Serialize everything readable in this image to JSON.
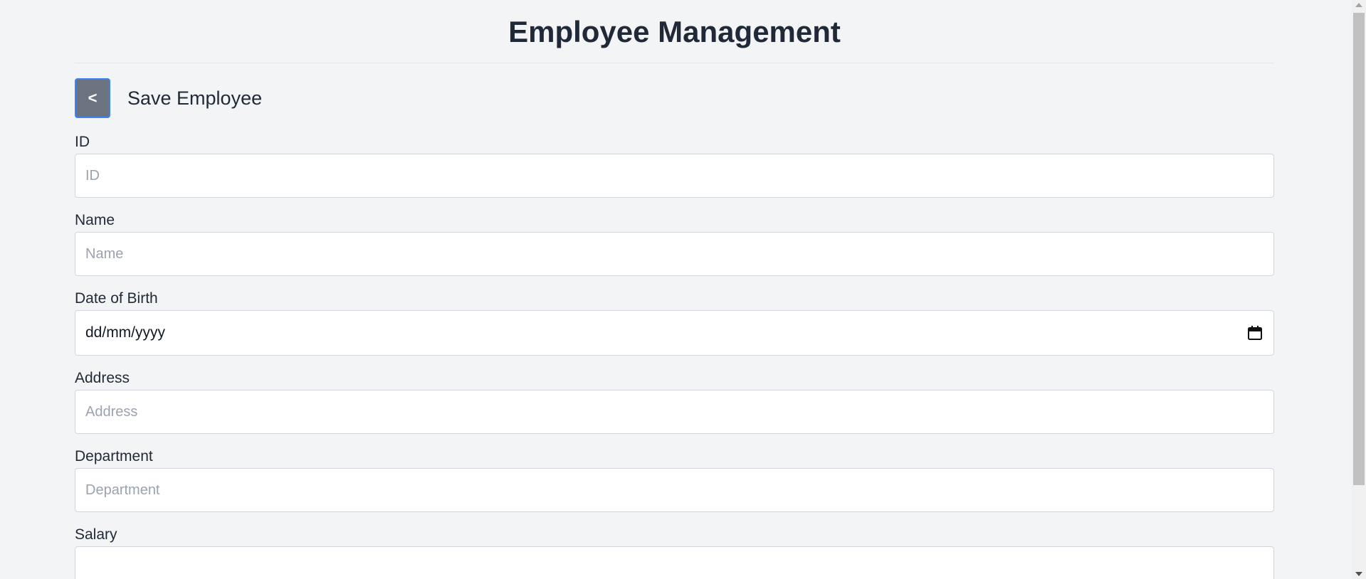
{
  "app": {
    "title": "Employee Management"
  },
  "subheader": {
    "back_label": "<",
    "title": "Save Employee"
  },
  "form": {
    "id": {
      "label": "ID",
      "placeholder": "ID",
      "value": ""
    },
    "name": {
      "label": "Name",
      "placeholder": "Name",
      "value": ""
    },
    "dob": {
      "label": "Date of Birth",
      "display": "dd/mm/yyyy",
      "icon": "calendar-icon"
    },
    "address": {
      "label": "Address",
      "placeholder": "Address",
      "value": ""
    },
    "department": {
      "label": "Department",
      "placeholder": "Department",
      "value": ""
    },
    "salary": {
      "label": "Salary",
      "placeholder": "",
      "value": ""
    }
  },
  "colors": {
    "background": "#f3f4f6",
    "back_button": "#6b7280",
    "back_button_border": "#3b82f6",
    "text": "#1f2937",
    "placeholder": "#9ca3af"
  }
}
